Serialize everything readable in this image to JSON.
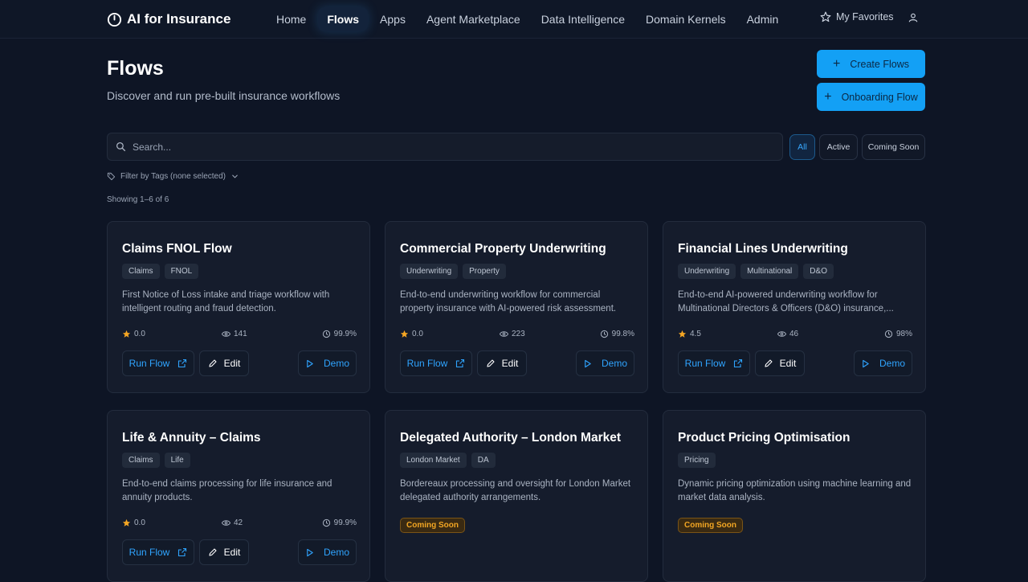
{
  "nav": {
    "logo": "AI for Insurance",
    "links": [
      "Home",
      "Flows",
      "Apps",
      "Agent Marketplace",
      "Data Intelligence",
      "Domain Kernels",
      "Admin"
    ],
    "active": "Flows",
    "favorites": "My Favorites"
  },
  "header": {
    "title": "Flows",
    "subtitle": "Discover and run pre-built insurance workflows",
    "create_button": "Create Flows",
    "onboarding_button": "Onboarding Flow"
  },
  "search": {
    "placeholder": "Search..."
  },
  "filters": {
    "all": "All",
    "active": "Active",
    "coming_soon": "Coming Soon",
    "selected": "All"
  },
  "tags_filter": "Filter by Tags (none selected)",
  "showing": "Showing 1–6 of 6",
  "buttons": {
    "run": "Run Flow",
    "edit": "Edit",
    "demo": "Demo"
  },
  "colors": {
    "accent": "#13a0f5",
    "star": "#f5a623",
    "coming_soon": "#f3a623",
    "background": "#0e1525"
  },
  "cards": [
    {
      "title": "Claims FNOL Flow",
      "tags": [
        "Claims",
        "FNOL"
      ],
      "desc": "First Notice of Loss intake and triage workflow with intelligent routing and fraud detection.",
      "rating": "0.0",
      "views": "141",
      "uptime": "99.9%",
      "status": "active"
    },
    {
      "title": "Commercial Property Underwriting",
      "tags": [
        "Underwriting",
        "Property"
      ],
      "desc": "End-to-end underwriting workflow for commercial property insurance with AI-powered risk assessment.",
      "rating": "0.0",
      "views": "223",
      "uptime": "99.8%",
      "status": "active"
    },
    {
      "title": "Financial Lines Underwriting",
      "tags": [
        "Underwriting",
        "Multinational",
        "D&O"
      ],
      "desc": "End-to-end AI-powered underwriting workflow for Multinational Directors & Officers (D&O) insurance,...",
      "rating": "4.5",
      "views": "46",
      "uptime": "98%",
      "status": "active"
    },
    {
      "title": "Life & Annuity – Claims",
      "tags": [
        "Claims",
        "Life"
      ],
      "desc": "End-to-end claims processing for life insurance and annuity products.",
      "rating": "0.0",
      "views": "42",
      "uptime": "99.9%",
      "status": "active"
    },
    {
      "title": "Delegated Authority – London Market",
      "tags": [
        "London Market",
        "DA"
      ],
      "desc": "Bordereaux processing and oversight for London Market delegated authority arrangements.",
      "status": "coming_soon",
      "badge": "Coming Soon"
    },
    {
      "title": "Product Pricing Optimisation",
      "tags": [
        "Pricing"
      ],
      "desc": "Dynamic pricing optimization using machine learning and market data analysis.",
      "status": "coming_soon",
      "badge": "Coming Soon"
    }
  ]
}
